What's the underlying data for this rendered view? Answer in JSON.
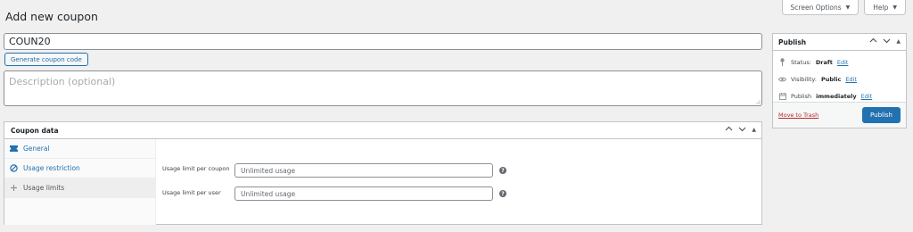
{
  "top_tabs": {
    "screen_options": "Screen Options",
    "help": "Help"
  },
  "page": {
    "title": "Add new coupon"
  },
  "coupon": {
    "code_value": "COUN20",
    "generate_label": "Generate coupon code",
    "description_placeholder": "Description (optional)"
  },
  "coupon_data": {
    "title": "Coupon data",
    "tabs": [
      {
        "label": "General",
        "icon": "ticket-icon"
      },
      {
        "label": "Usage restriction",
        "icon": "block-icon"
      },
      {
        "label": "Usage limits",
        "icon": "plus-icon"
      }
    ],
    "fields": [
      {
        "label": "Usage limit per coupon",
        "placeholder": "Unlimited usage"
      },
      {
        "label": "Usage limit per user",
        "placeholder": "Unlimited usage"
      }
    ]
  },
  "publish": {
    "title": "Publish",
    "status_label": "Status:",
    "status_value": "Draft",
    "visibility_label": "Visibility:",
    "visibility_value": "Public",
    "publish_label": "Publish",
    "publish_value": "immediately",
    "edit_label": "Edit",
    "trash_label": "Move to Trash",
    "publish_button": "Publish"
  },
  "colors": {
    "accent": "#2271b1",
    "danger": "#b32d2e",
    "background": "#f0f0f1"
  }
}
